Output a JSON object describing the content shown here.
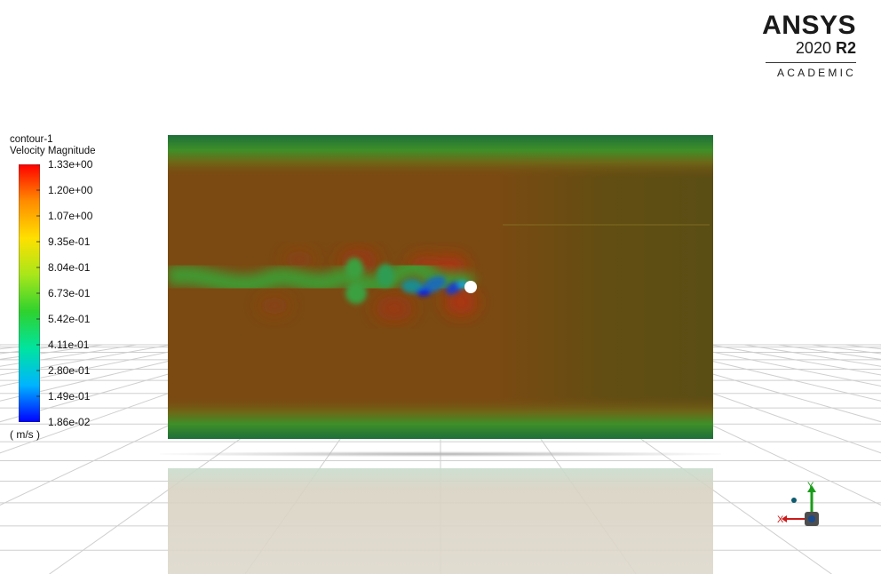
{
  "logo": {
    "brand": "ANSYS",
    "version": "2020",
    "release": "R2",
    "edition": "ACADEMIC"
  },
  "legend": {
    "name": "contour-1",
    "variable": "Velocity Magnitude",
    "units": "( m/s )",
    "ticks": [
      "1.33e+00",
      "1.20e+00",
      "1.07e+00",
      "9.35e-01",
      "8.04e-01",
      "6.73e-01",
      "5.42e-01",
      "4.11e-01",
      "2.80e-01",
      "1.49e-01",
      "1.86e-02"
    ],
    "min": 0.0186,
    "max": 1.33,
    "colormap": [
      "#0000ff",
      "#00b4ff",
      "#00e4a0",
      "#2ed22e",
      "#a8e61a",
      "#ffe000",
      "#ff8c00",
      "#ff0000"
    ]
  },
  "triad": {
    "y_label": "Y",
    "x_label": "X",
    "y_color": "#1a9c1a",
    "x_color": "#cc1a1a"
  },
  "colors": {
    "field_bg": "#7a4a12",
    "wake": "#3a9c3a",
    "obstacle": "#ffffff"
  }
}
